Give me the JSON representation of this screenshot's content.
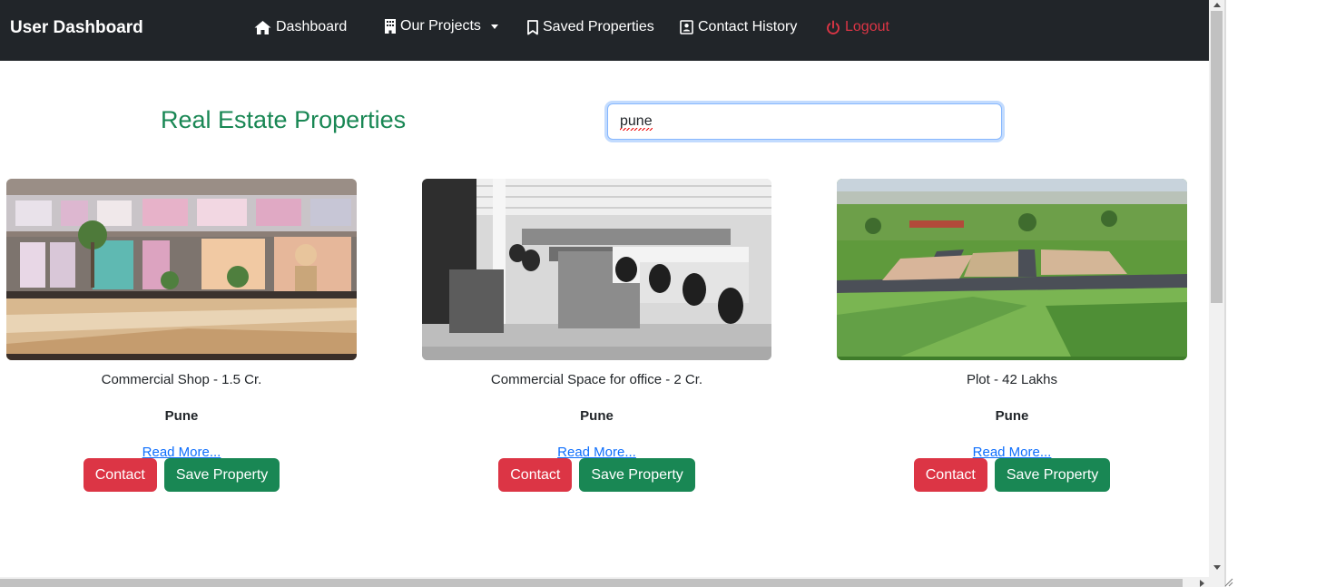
{
  "navbar": {
    "brand": "User Dashboard",
    "items": [
      {
        "label": "Dashboard",
        "icon": "house-icon"
      },
      {
        "label": "Our Projects",
        "icon": "building-icon"
      },
      {
        "label": "Saved Properties",
        "icon": "bookmark-icon"
      },
      {
        "label": "Contact History",
        "icon": "contact-card-icon"
      },
      {
        "label": "Logout",
        "icon": "power-icon"
      }
    ]
  },
  "main": {
    "title": "Real Estate Properties",
    "search": {
      "value": "pune",
      "placeholder": ""
    }
  },
  "properties": [
    {
      "title": "Commercial Shop - 1.5 Cr.",
      "city": "Pune",
      "link": "Read More...",
      "contact_label": "Contact",
      "save_label": "Save Property"
    },
    {
      "title": "Commercial Space for office - 2 Cr.",
      "city": "Pune",
      "link": "Read More...",
      "contact_label": "Contact",
      "save_label": "Save Property"
    },
    {
      "title": "Plot - 42 Lakhs",
      "city": "Pune",
      "link": "Read More...",
      "contact_label": "Contact",
      "save_label": "Save Property"
    }
  ],
  "colors": {
    "navbar_bg": "#212529",
    "title_green": "#198754",
    "contact_red": "#dc3545",
    "save_green": "#198754",
    "link_blue": "#0d6efd",
    "logout_red": "#dc3545"
  }
}
